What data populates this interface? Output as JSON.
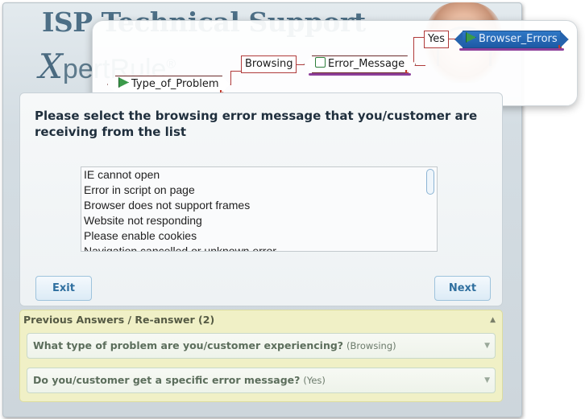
{
  "brand": {
    "title": "ISP Technical Support",
    "logo_x": "X",
    "logo_rest": "pertRule",
    "logo_mark": "®"
  },
  "breadcrumb": {
    "nodes": [
      {
        "label": "Type_of_Problem",
        "icon": "goal-icon"
      },
      {
        "label": "Browsing"
      },
      {
        "label": "Error_Message",
        "icon": "rule-icon"
      },
      {
        "label": "Yes"
      },
      {
        "label": "Browser_Errors",
        "icon": "goal-icon",
        "selected": true
      }
    ]
  },
  "question": {
    "text": "Please select the browsing error message that you/customer are receiving from the list"
  },
  "options": [
    "IE cannot open",
    "Error in script on page",
    "Browser does not support frames",
    "Website not responding",
    "Please enable cookies",
    "Navigation cancelled or unknown error"
  ],
  "buttons": {
    "exit": "Exit",
    "next": "Next"
  },
  "previous": {
    "header": "Previous Answers / Re-answer (2)",
    "items": [
      {
        "question": "What type of problem are you/customer experiencing?",
        "answer": "(Browsing)"
      },
      {
        "question": "Do you/customer get a specific error message?",
        "answer": "(Yes)"
      }
    ]
  },
  "colors": {
    "accent": "#2f6f9f",
    "selected_node": "#1d5aa5",
    "connector": "#b03a3a",
    "previous_bg": "#f0f0c6"
  }
}
